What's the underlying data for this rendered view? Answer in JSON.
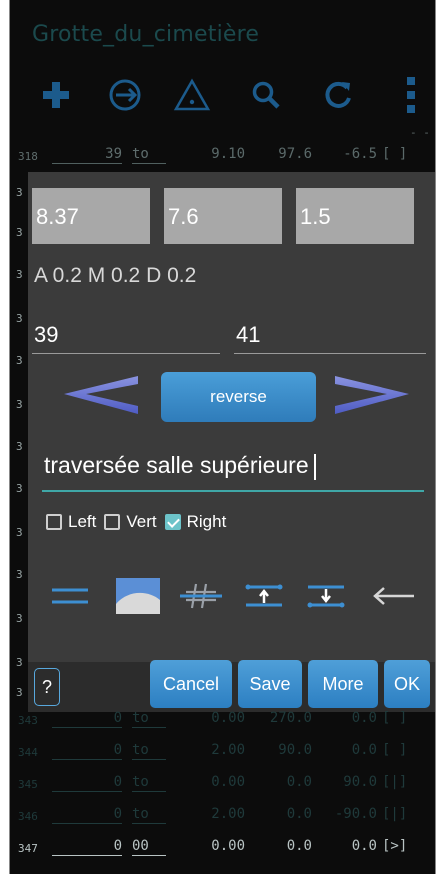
{
  "app": {
    "title": "Grotte_du_cimetière"
  },
  "toolbar": {
    "icons": [
      "plus-icon",
      "circle-arrow-icon",
      "warning-triangle-icon",
      "search-icon",
      "refresh-icon",
      "overflow-menu-icon"
    ]
  },
  "shots_above": [
    {
      "num": "318",
      "from": "39",
      "to": "to",
      "len": "9.10",
      "az": "97.6",
      "cl": "-6.5",
      "flag": "[ ]"
    }
  ],
  "shots_below": [
    {
      "num": "343",
      "from": "0",
      "to": "to",
      "len": "0.00",
      "az": "270.0",
      "cl": "0.0",
      "flag": "[ ]"
    },
    {
      "num": "344",
      "from": "0",
      "to": "to",
      "len": "2.00",
      "az": "90.0",
      "cl": "0.0",
      "flag": "[ ]"
    },
    {
      "num": "345",
      "from": "0",
      "to": "to",
      "len": "0.00",
      "az": "0.0",
      "cl": "90.0",
      "flag": "[|]"
    },
    {
      "num": "346",
      "from": "0",
      "to": "to",
      "len": "2.00",
      "az": "0.0",
      "cl": "-90.0",
      "flag": "[|]"
    },
    {
      "num": "347",
      "from": "0",
      "to": "00",
      "len": "0.00",
      "az": "0.0",
      "cl": "0.0",
      "flag": "[>]"
    }
  ],
  "dialog": {
    "distance": "8.37",
    "azimuth": "7.6",
    "clino": "1.5",
    "amd": "A 0.2  M 0.2  D 0.2",
    "from_station": "39",
    "to_station": "41",
    "reverse_label": "reverse",
    "comment": "traversée salle supérieure",
    "checks": [
      {
        "label": "Left",
        "checked": false
      },
      {
        "label": "Vert",
        "checked": false
      },
      {
        "label": "Right",
        "checked": true
      }
    ],
    "tools": [
      "double-line-icon",
      "surface-profile-icon",
      "hash-strike-icon",
      "extend-up-icon",
      "extend-down-icon",
      "back-arrow-icon"
    ],
    "help_label": "?",
    "cancel_label": "Cancel",
    "save_label": "Save",
    "more_label": "More",
    "ok_label": "OK"
  },
  "colors": {
    "background": "#0c0c0c",
    "dialog": "#3b3b3b",
    "accent": "#2f7cba",
    "teal": "#1b4a4d",
    "check": "#6cc3c9"
  }
}
